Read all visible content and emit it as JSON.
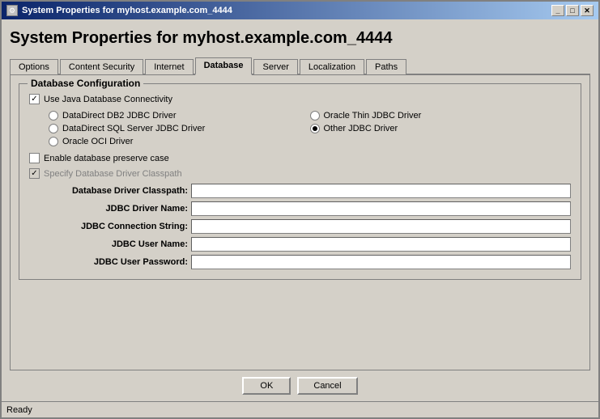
{
  "window": {
    "title": "System Properties for myhost.example.com_4444",
    "title_prefix": "System Properties for ",
    "title_host": "myhost.example.com_4444"
  },
  "titlebar": {
    "icon": "⚙",
    "minimize_label": "_",
    "maximize_label": "□",
    "close_label": "✕"
  },
  "tabs": [
    {
      "id": "options",
      "label": "Options",
      "active": false
    },
    {
      "id": "content-security",
      "label": "Content Security",
      "active": false
    },
    {
      "id": "internet",
      "label": "Internet",
      "active": false
    },
    {
      "id": "database",
      "label": "Database",
      "active": true
    },
    {
      "id": "server",
      "label": "Server",
      "active": false
    },
    {
      "id": "localization",
      "label": "Localization",
      "active": false
    },
    {
      "id": "paths",
      "label": "Paths",
      "active": false
    }
  ],
  "database": {
    "group_title": "Database Configuration",
    "use_jdbc_label": "Use Java Database Connectivity",
    "use_jdbc_checked": true,
    "drivers": {
      "left": [
        {
          "id": "datadirect-db2",
          "label": "DataDirect DB2 JDBC Driver",
          "checked": false
        },
        {
          "id": "datadirect-sql",
          "label": "DataDirect SQL Server JDBC Driver",
          "checked": false
        },
        {
          "id": "oracle-oci",
          "label": "Oracle OCI Driver",
          "checked": false
        }
      ],
      "right": [
        {
          "id": "oracle-thin",
          "label": "Oracle Thin JDBC Driver",
          "checked": false
        },
        {
          "id": "other-jdbc",
          "label": "Other JDBC Driver",
          "checked": true
        }
      ]
    },
    "preserve_case_label": "Enable database preserve case",
    "preserve_case_checked": false,
    "specify_classpath_label": "Specify Database Driver Classpath",
    "specify_classpath_checked": true,
    "specify_classpath_disabled": true,
    "fields": [
      {
        "label": "Database Driver Classpath:",
        "id": "driver-classpath",
        "value": ""
      },
      {
        "label": "JDBC Driver Name:",
        "id": "driver-name",
        "value": ""
      },
      {
        "label": "JDBC Connection String:",
        "id": "connection-string",
        "value": ""
      },
      {
        "label": "JDBC User Name:",
        "id": "user-name",
        "value": ""
      },
      {
        "label": "JDBC User Password:",
        "id": "user-password",
        "value": ""
      }
    ]
  },
  "buttons": {
    "ok": "OK",
    "cancel": "Cancel"
  },
  "status": "Ready"
}
